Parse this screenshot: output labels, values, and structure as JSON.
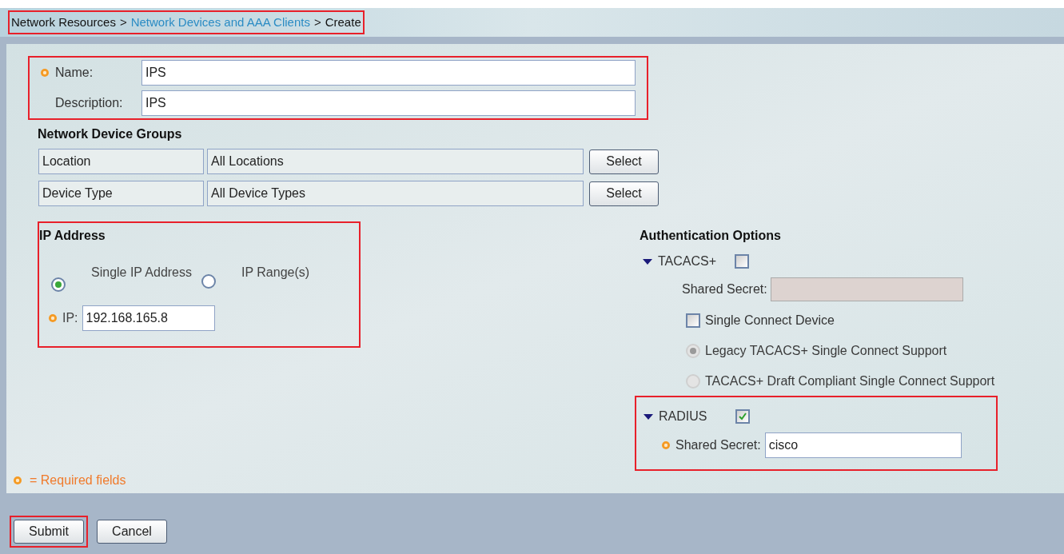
{
  "breadcrumb": {
    "highlighted": true,
    "separator": ">",
    "items": [
      {
        "text": "Network Resources",
        "link": false
      },
      {
        "text": "Network Devices and AAA Clients",
        "link": true
      },
      {
        "text": "Create",
        "link": false
      }
    ]
  },
  "general": {
    "highlighted": true,
    "fields": [
      {
        "label": "Name:",
        "value": "IPS",
        "required": true
      },
      {
        "label": "Description:",
        "value": "IPS",
        "required": false
      }
    ]
  },
  "device_groups": {
    "title": "Network Device Groups",
    "rows": [
      {
        "name": "Location",
        "value": "All Locations",
        "button": "Select"
      },
      {
        "name": "Device Type",
        "value": "All Device Types",
        "button": "Select"
      }
    ]
  },
  "ip_address": {
    "title": "IP Address",
    "highlighted": true,
    "options": [
      {
        "label": "Single IP Address",
        "selected": true
      },
      {
        "label": "IP Range(s)",
        "selected": false
      }
    ],
    "ip": {
      "label": "IP:",
      "value": "192.168.165.8",
      "required": true
    }
  },
  "authentication": {
    "title": "Authentication Options",
    "tacacs": {
      "label": "TACACS+",
      "checked": false,
      "expanded": true,
      "shared_secret": {
        "label": "Shared Secret:",
        "disabled": true
      },
      "single_connect": {
        "label": "Single Connect Device",
        "checked": false
      },
      "modes": [
        {
          "label": "Legacy TACACS+ Single Connect Support",
          "selected": true,
          "disabled": true
        },
        {
          "label": "TACACS+ Draft Compliant Single Connect Support",
          "selected": false,
          "disabled": true
        }
      ]
    },
    "radius": {
      "label": "RADIUS",
      "checked": true,
      "expanded": true,
      "highlighted": true,
      "shared_secret": {
        "label": "Shared Secret:",
        "value": "cisco",
        "required": true
      }
    }
  },
  "legend": {
    "text": "= Required fields"
  },
  "actions": [
    {
      "label": "Submit",
      "highlighted": true
    },
    {
      "label": "Cancel",
      "highlighted": false
    }
  ]
}
